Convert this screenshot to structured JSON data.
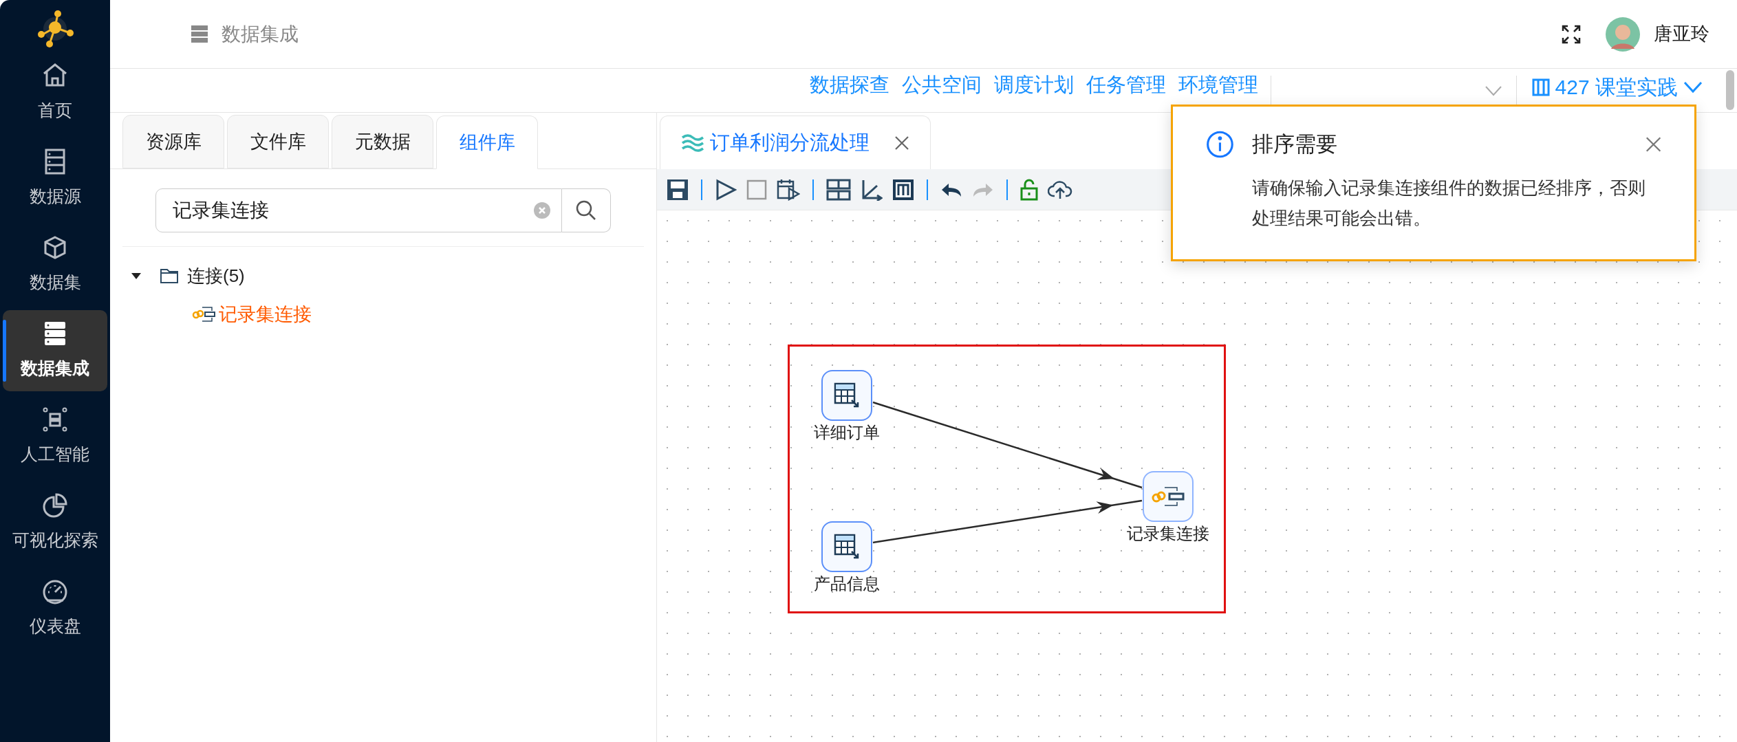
{
  "sidebar": {
    "items": [
      {
        "label": "首页",
        "selected": false
      },
      {
        "label": "数据源",
        "selected": false
      },
      {
        "label": "数据集",
        "selected": false
      },
      {
        "label": "数据集成",
        "selected": true
      },
      {
        "label": "人工智能",
        "selected": false
      },
      {
        "label": "可视化探索",
        "selected": false
      },
      {
        "label": "仪表盘",
        "selected": false
      }
    ]
  },
  "header": {
    "breadcrumb": "数据集成",
    "user": "唐亚玲"
  },
  "nav_links": [
    "数据探查",
    "公共空间",
    "调度计划",
    "任务管理",
    "环境管理"
  ],
  "project": "427 课堂实践",
  "library": {
    "tabs": [
      {
        "label": "资源库",
        "selected": false
      },
      {
        "label": "文件库",
        "selected": false
      },
      {
        "label": "元数据",
        "selected": false
      },
      {
        "label": "组件库",
        "selected": true
      }
    ],
    "search": {
      "value": "记录集连接"
    },
    "tree": [
      {
        "label": "连接(5)",
        "expanded": true,
        "children": [
          {
            "label": "记录集连接",
            "highlighted": true
          }
        ]
      }
    ]
  },
  "editor": {
    "tabs": [
      {
        "label": "订单利润分流处理",
        "selected": true
      }
    ],
    "nodes": [
      {
        "label": "详细订单",
        "kind": "source"
      },
      {
        "label": "产品信息",
        "kind": "source"
      },
      {
        "label": "记录集连接",
        "kind": "join"
      }
    ]
  },
  "notification": {
    "title": "排序需要",
    "message": "请确保输入记录集连接组件的数据已经排序，否则处理结果可能会出错。"
  }
}
